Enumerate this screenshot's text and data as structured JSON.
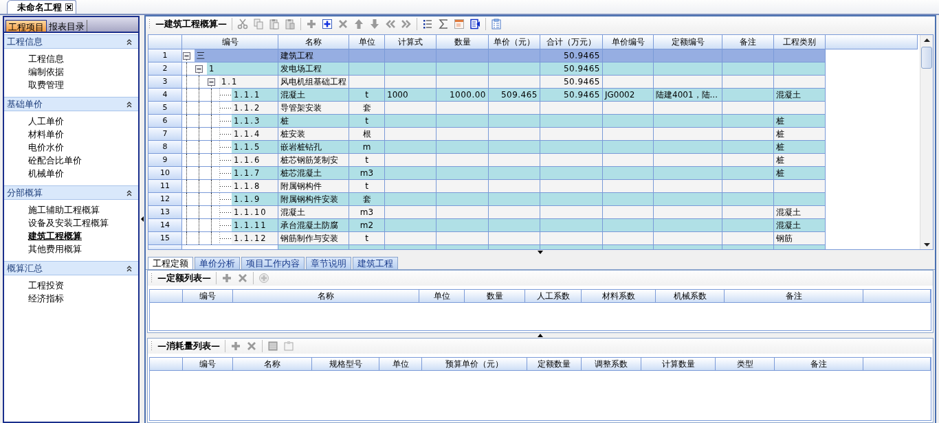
{
  "document_tab": {
    "title": "未命名工程"
  },
  "sidebar": {
    "tabs": [
      {
        "label": "工程项目",
        "selected": true
      },
      {
        "label": "报表目录",
        "selected": false
      }
    ],
    "sections": [
      {
        "title": "工程信息",
        "expanded": true,
        "items": [
          {
            "label": "工程信息",
            "selected": false
          },
          {
            "label": "编制依据",
            "selected": false
          },
          {
            "label": "取费管理",
            "selected": false
          }
        ]
      },
      {
        "title": "基础单价",
        "expanded": true,
        "items": [
          {
            "label": "人工单价",
            "selected": false
          },
          {
            "label": "材料单价",
            "selected": false
          },
          {
            "label": "电价水价",
            "selected": false
          },
          {
            "label": "砼配合比单价",
            "selected": false
          },
          {
            "label": "机械单价",
            "selected": false
          }
        ]
      },
      {
        "title": "分部概算",
        "expanded": true,
        "items": [
          {
            "label": "施工辅助工程概算",
            "selected": false
          },
          {
            "label": "设备及安装工程概算",
            "selected": false
          },
          {
            "label": "建筑工程概算",
            "selected": true
          },
          {
            "label": "其他费用概算",
            "selected": false
          }
        ]
      },
      {
        "title": "概算汇总",
        "expanded": true,
        "items": [
          {
            "label": "工程投资",
            "selected": false
          },
          {
            "label": "经济指标",
            "selected": false
          }
        ]
      }
    ]
  },
  "main_grid": {
    "title": "—建筑工程概算—",
    "columns": [
      "编号",
      "名称",
      "单位",
      "计算式",
      "数量",
      "单价（元）",
      "合计（万元）",
      "单价编号",
      "定额编号",
      "备注",
      "工程类别"
    ],
    "rows": [
      {
        "no": "1",
        "code": "三",
        "name": "建筑工程",
        "total": "50.9465",
        "selected": true,
        "expanded": true,
        "children": [
          {
            "no": "2",
            "code": "1",
            "name": "发电场工程",
            "total": "50.9465",
            "selected": false,
            "expanded": true,
            "children": [
              {
                "no": "3",
                "code": "1.1",
                "name": "风电机组基础工程",
                "total": "50.9465",
                "selected": false,
                "expanded": true,
                "children": [
                  {
                    "no": "4",
                    "code": "1.1.1",
                    "name": "混凝土",
                    "unit": "t",
                    "formula": "1000",
                    "quantity": "1000.00",
                    "unit_price": "509.465",
                    "total": "50.9465",
                    "price_code": "JG0002",
                    "quota_code": "陆建4001，陆...",
                    "category": "混凝土",
                    "selected": false
                  },
                  {
                    "no": "5",
                    "code": "1.1.2",
                    "name": "导管架安装",
                    "unit": "套",
                    "selected": false
                  },
                  {
                    "no": "6",
                    "code": "1.1.3",
                    "name": "桩",
                    "unit": "t",
                    "category": "桩",
                    "selected": false
                  },
                  {
                    "no": "7",
                    "code": "1.1.4",
                    "name": "桩安装",
                    "unit": "根",
                    "category": "桩",
                    "selected": false
                  },
                  {
                    "no": "8",
                    "code": "1.1.5",
                    "name": "嵌岩桩钻孔",
                    "unit": "m",
                    "category": "桩",
                    "selected": false
                  },
                  {
                    "no": "9",
                    "code": "1.1.6",
                    "name": "桩芯钢筋笼制安",
                    "unit": "t",
                    "category": "桩",
                    "selected": false
                  },
                  {
                    "no": "10",
                    "code": "1.1.7",
                    "name": "桩芯混凝土",
                    "unit": "m3",
                    "category": "桩",
                    "selected": false
                  },
                  {
                    "no": "11",
                    "code": "1.1.8",
                    "name": "附属钢构件",
                    "unit": "t",
                    "selected": false
                  },
                  {
                    "no": "12",
                    "code": "1.1.9",
                    "name": "附属钢构件安装",
                    "unit": "套",
                    "selected": false
                  },
                  {
                    "no": "13",
                    "code": "1.1.10",
                    "name": "混凝土",
                    "unit": "m3",
                    "category": "混凝土",
                    "selected": false
                  },
                  {
                    "no": "14",
                    "code": "1.1.11",
                    "name": "承台混凝土防腐",
                    "unit": "m2",
                    "category": "混凝土",
                    "selected": false
                  },
                  {
                    "no": "15",
                    "code": "1.1.12",
                    "name": "钢筋制作与安装",
                    "unit": "t",
                    "category": "钢筋",
                    "selected": false
                  }
                ]
              }
            ]
          }
        ]
      }
    ]
  },
  "bottom_tabs": [
    {
      "label": "工程定额",
      "selected": true
    },
    {
      "label": "单价分析",
      "selected": false
    },
    {
      "label": "项目工作内容",
      "selected": false
    },
    {
      "label": "章节说明",
      "selected": false
    },
    {
      "label": "建筑工程",
      "selected": false
    }
  ],
  "quota_list": {
    "title": "—定额列表—",
    "columns": [
      "编号",
      "名称",
      "单位",
      "数量",
      "人工系数",
      "材料系数",
      "机械系数",
      "备注"
    ]
  },
  "consumption_list": {
    "title": "—消耗量列表—",
    "columns": [
      "编号",
      "名称",
      "规格型号",
      "单位",
      "预算单价（元）",
      "定额数量",
      "调整系数",
      "计算数量",
      "类型",
      "备注"
    ]
  }
}
